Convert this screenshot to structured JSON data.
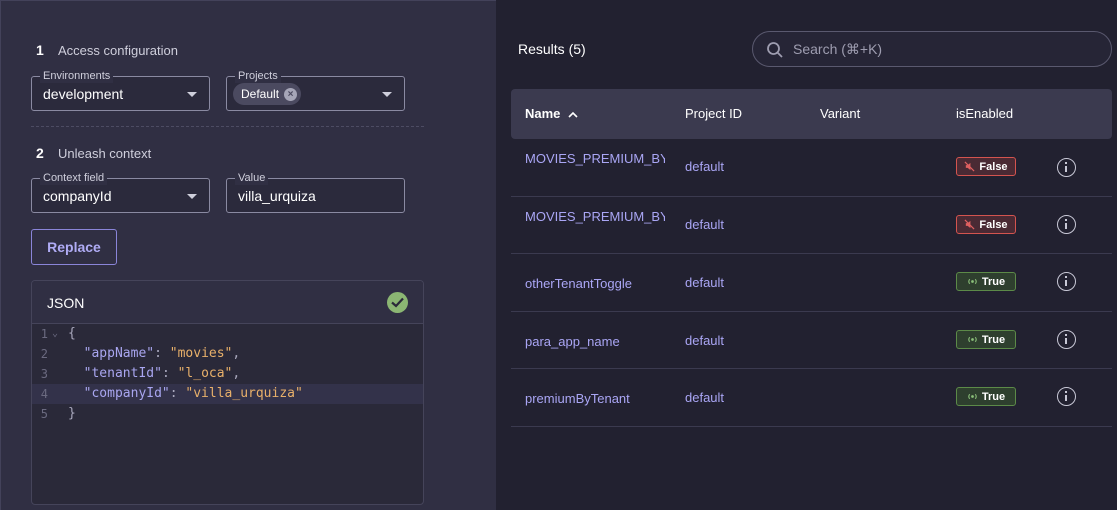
{
  "access": {
    "step_num": "1",
    "step_label": "Access configuration",
    "environments": {
      "legend": "Environments",
      "value": "development"
    },
    "projects": {
      "legend": "Projects",
      "chip": "Default"
    }
  },
  "context": {
    "step_num": "2",
    "step_label": "Unleash context",
    "field": {
      "legend": "Context field",
      "value": "companyId"
    },
    "value": {
      "legend": "Value",
      "value": "villa_urquiza"
    }
  },
  "replace_label": "Replace",
  "json_panel": {
    "title": "JSON",
    "lines": [
      {
        "n": "1",
        "text": "{"
      },
      {
        "n": "2",
        "key": "\"appName\"",
        "val": "\"movies\"",
        "end": ","
      },
      {
        "n": "3",
        "key": "\"tenantId\"",
        "val": "\"l_oca\"",
        "end": ","
      },
      {
        "n": "4",
        "key": "\"companyId\"",
        "val": "\"villa_urquiza\"",
        "end": ""
      },
      {
        "n": "5",
        "text": "}"
      }
    ]
  },
  "results": {
    "title": "Results (5)",
    "search_placeholder": "Search (⌘+K)",
    "columns": {
      "name": "Name",
      "project": "Project ID",
      "variant": "Variant",
      "enabled": "isEnabled"
    },
    "rows": [
      {
        "name": "MOVIES_PREMIUM_BY_TENANTID_AND…",
        "project": "default",
        "variant": "",
        "enabled": "False"
      },
      {
        "name": "MOVIES_PREMIUM_BY_TRIAL",
        "project": "default",
        "variant": "",
        "enabled": "False"
      },
      {
        "name": "otherTenantToggle",
        "project": "default",
        "variant": "",
        "enabled": "True"
      },
      {
        "name": "para_app_name",
        "project": "default",
        "variant": "",
        "enabled": "True"
      },
      {
        "name": "premiumByTenant",
        "project": "default",
        "variant": "",
        "enabled": "True"
      }
    ]
  },
  "colors": {
    "accent": "#aaa6f5",
    "false_border": "#d4544f",
    "true_border": "#5c8a48",
    "check_ok": "#8bb673"
  },
  "icons": {
    "search": "search-icon",
    "info": "info-icon",
    "check": "check-circle-icon",
    "chip_remove": "close-circle-icon",
    "sort": "chevron-up-icon"
  }
}
